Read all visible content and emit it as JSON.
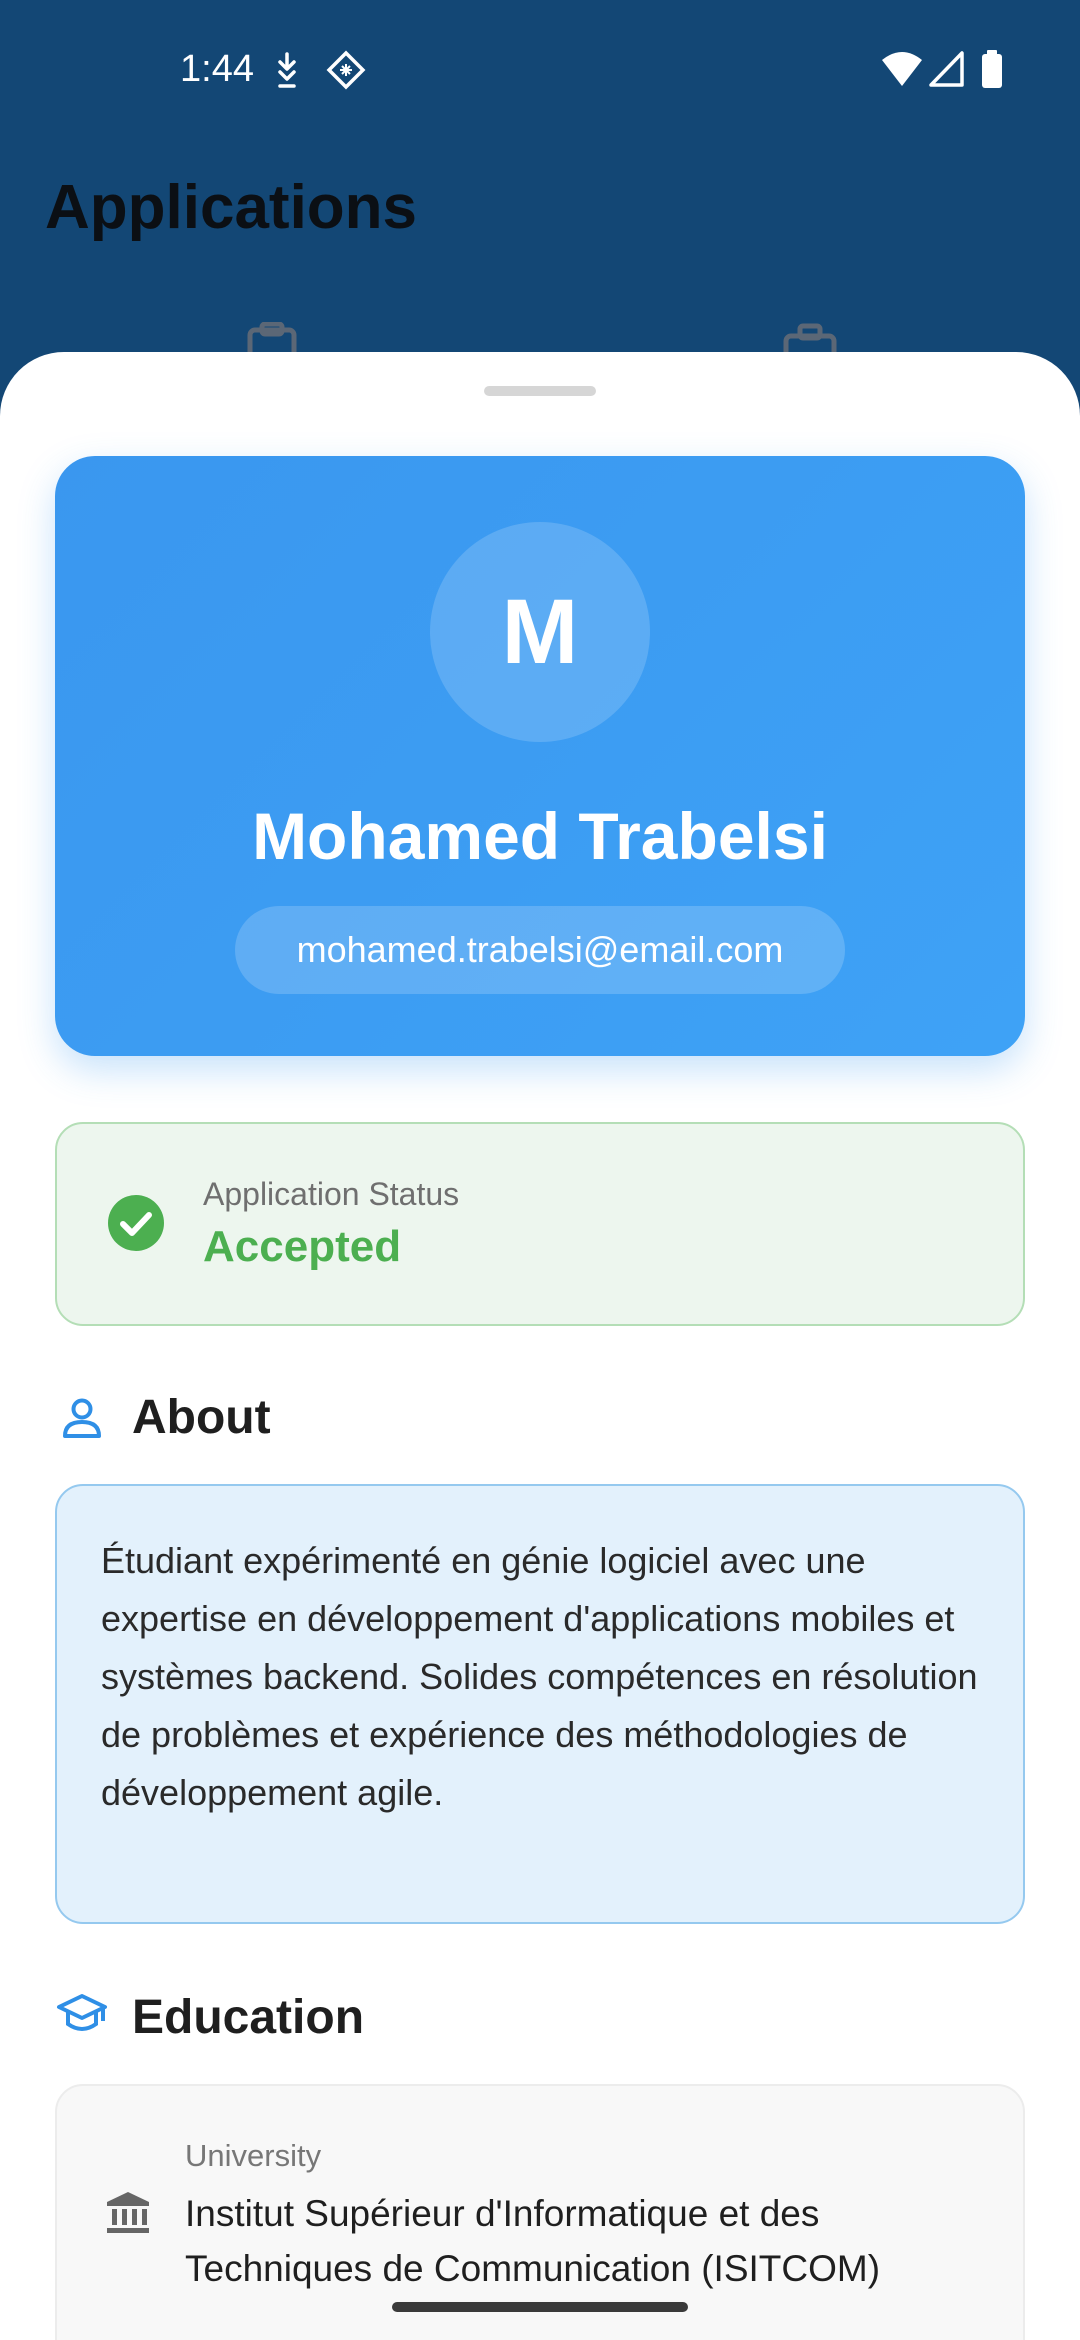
{
  "status_bar": {
    "time": "1:44",
    "icons": [
      "download-notification-icon",
      "app-notification-icon",
      "wifi-icon",
      "cellular-signal-icon",
      "battery-icon"
    ]
  },
  "background": {
    "title": "Applications",
    "tab_icons": [
      "clipboard-icon",
      "briefcase-icon"
    ]
  },
  "profile": {
    "avatar_initial": "M",
    "name": "Mohamed Trabelsi",
    "email": "mohamed.trabelsi@email.com",
    "card_color": "#3a97ef"
  },
  "status": {
    "label": "Application Status",
    "value": "Accepted",
    "color": "#4caf50",
    "icon": "check-circle-icon"
  },
  "about": {
    "title": "About",
    "icon": "person-icon",
    "text": "Étudiant expérimenté en génie logiciel avec une expertise en développement d'applications mobiles et systèmes backend. Solides compétences en résolution de problèmes et expérience des méthodologies de développement agile."
  },
  "education": {
    "title": "Education",
    "icon": "graduation-cap-icon",
    "university_label": "University",
    "university_value": "Institut Supérieur d'Informatique et des Techniques de Communication (ISITCOM)",
    "university_icon": "institution-icon"
  },
  "colors": {
    "accent": "#2f8fe6",
    "header_bg": "#134775"
  }
}
